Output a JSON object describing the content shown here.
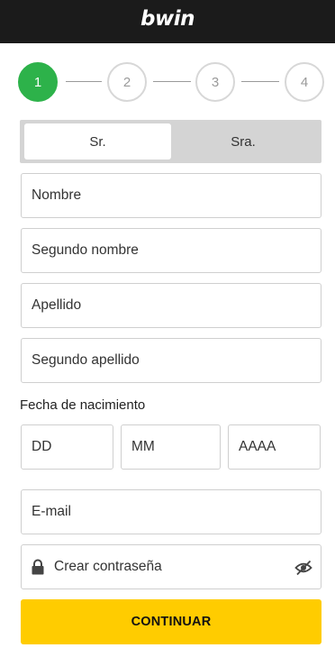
{
  "header": {
    "logo_text": "bwin"
  },
  "stepper": {
    "steps": [
      "1",
      "2",
      "3",
      "4"
    ],
    "active_step": 1
  },
  "gender": {
    "options": [
      "Sr.",
      "Sra."
    ],
    "selected": "Sr."
  },
  "form": {
    "first_name_placeholder": "Nombre",
    "middle_name_placeholder": "Segundo nombre",
    "last_name_placeholder": "Apellido",
    "second_last_name_placeholder": "Segundo apellido",
    "birthdate_label": "Fecha de nacimiento",
    "day_placeholder": "DD",
    "month_placeholder": "MM",
    "year_placeholder": "AAAA",
    "email_placeholder": "E-mail",
    "password_placeholder": "Crear contraseña"
  },
  "icons": {
    "password_lock": "lock-icon",
    "password_visibility": "eye-off-icon"
  },
  "colors": {
    "header_bg": "#1b1b1b",
    "active_step": "#2db24a",
    "cta_bg": "#ffcc00"
  },
  "cta": {
    "label": "CONTINUAR"
  }
}
